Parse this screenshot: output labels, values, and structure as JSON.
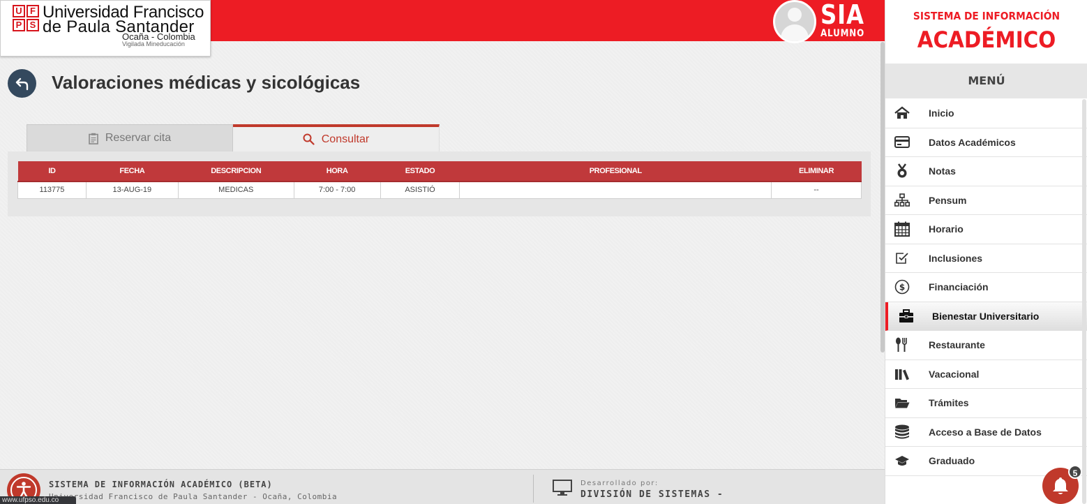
{
  "header": {
    "logo_letters": [
      "U",
      "F",
      "P",
      "S"
    ],
    "uni_name_line1": "Universidad Francisco",
    "uni_name_line2": "de Paula Santander",
    "uni_city": "Ocaña - Colombia",
    "uni_vigilada": "Vigilada Mineducación",
    "sia_title": "SIA",
    "sia_sub": "ALUMNO",
    "brand_color": "#ed1c24"
  },
  "page": {
    "title": "Valoraciones médicas y sicológicas"
  },
  "tabs": [
    {
      "label": "Reservar cita",
      "icon": "clipboard-icon",
      "active": false
    },
    {
      "label": "Consultar",
      "icon": "search-icon",
      "active": true
    }
  ],
  "table": {
    "columns": [
      "ID",
      "FECHA",
      "DESCRIPCION",
      "HORA",
      "ESTADO",
      "PROFESIONAL",
      "ELIMINAR"
    ],
    "rows": [
      [
        "113775",
        "13-AUG-19",
        "MEDICAS",
        "7:00 - 7:00",
        "ASISTIÓ",
        "",
        "--"
      ]
    ],
    "header_color": "#c0393b"
  },
  "sidebar": {
    "top_line1": "SISTEMA DE INFORMACIÓN",
    "top_line2": "ACADÉMICO",
    "menu_title": "MENÚ",
    "items": [
      {
        "label": "Inicio",
        "icon": "home-icon"
      },
      {
        "label": "Datos Académicos",
        "icon": "card-icon"
      },
      {
        "label": "Notas",
        "icon": "medal-icon"
      },
      {
        "label": "Pensum",
        "icon": "sitemap-icon"
      },
      {
        "label": "Horario",
        "icon": "calendar-icon"
      },
      {
        "label": "Inclusiones",
        "icon": "checkbox-icon"
      },
      {
        "label": "Financiación",
        "icon": "dollar-icon"
      },
      {
        "label": "Bienestar Universitario",
        "icon": "briefcase-icon",
        "active": true
      },
      {
        "label": "Restaurante",
        "icon": "utensils-icon"
      },
      {
        "label": "Vacacional",
        "icon": "books-icon"
      },
      {
        "label": "Trámites",
        "icon": "folder-open-icon"
      },
      {
        "label": "Acceso a Base de Datos",
        "icon": "database-icon"
      },
      {
        "label": "Graduado",
        "icon": "graduation-cap-icon"
      }
    ]
  },
  "footer": {
    "title": "SISTEMA DE INFORMACIÓN ACADÉMICO (BETA)",
    "subtitle": "Universidad Francisco de Paula Santander - Ocaña, Colombia",
    "dev_label": "Desarrollado por:",
    "dev_name": "DIVISIÓN DE SISTEMAS -",
    "url_tip": "www.ufpso.edu.co"
  },
  "notifications": {
    "count": "5"
  }
}
